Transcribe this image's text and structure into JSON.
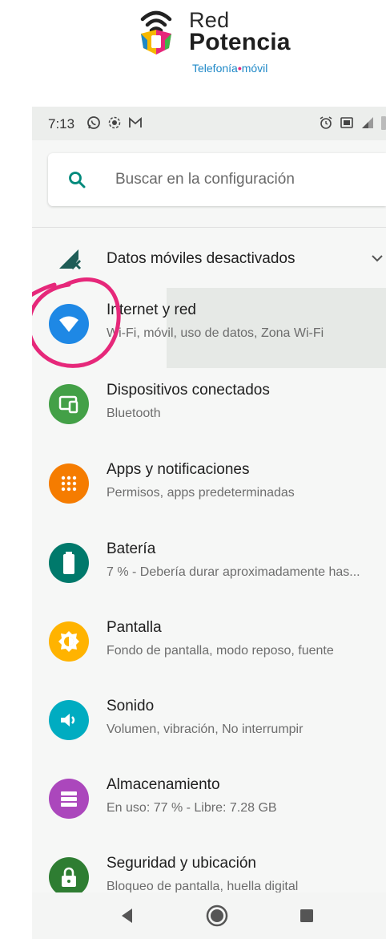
{
  "brand": {
    "line1": "Red",
    "line2": "Potencia",
    "tagline_a": "Telefonía",
    "tagline_sep": "•",
    "tagline_b": "móvil",
    "colors": {
      "blue": "#1e88c7",
      "pink": "#e6287a",
      "yellow": "#f6b800",
      "green": "#41b649"
    }
  },
  "status_bar": {
    "time": "7:13",
    "icons_left": [
      "whatsapp-icon",
      "record-icon",
      "gmail-icon"
    ],
    "icons_right": [
      "alarm-icon",
      "cast-icon",
      "signal-icon",
      "battery-icon"
    ]
  },
  "search": {
    "placeholder": "Buscar en la configuración",
    "icon": "search-icon"
  },
  "mobile_data_banner": {
    "label": "Datos móviles desactivados",
    "icon": "mobile-data-off-icon"
  },
  "settings": [
    {
      "title": "Internet y red",
      "subtitle": "Wi-Fi, móvil, uso de datos, Zona Wi-Fi",
      "icon": "wifi-icon",
      "color": "#1e88e5"
    },
    {
      "title": "Dispositivos conectados",
      "subtitle": "Bluetooth",
      "icon": "devices-icon",
      "color": "#43a047"
    },
    {
      "title": "Apps y notificaciones",
      "subtitle": "Permisos, apps predeterminadas",
      "icon": "apps-icon",
      "color": "#f57c00"
    },
    {
      "title": "Batería",
      "subtitle": "7 % - Debería durar aproximadamente has...",
      "icon": "battery-icon",
      "color": "#00796b"
    },
    {
      "title": "Pantalla",
      "subtitle": "Fondo de pantalla, modo reposo, fuente",
      "icon": "brightness-icon",
      "color": "#ffb300"
    },
    {
      "title": "Sonido",
      "subtitle": "Volumen, vibración, No interrumpir",
      "icon": "volume-icon",
      "color": "#00acc1"
    },
    {
      "title": "Almacenamiento",
      "subtitle": "En uso: 77 % - Libre: 7.28 GB",
      "icon": "storage-icon",
      "color": "#ab47bc"
    },
    {
      "title": "Seguridad y ubicación",
      "subtitle": "Bloqueo de pantalla, huella digital",
      "icon": "lock-icon",
      "color": "#2e7d32"
    }
  ],
  "annotation": {
    "color": "#e6287a"
  },
  "nav": [
    "back-icon",
    "home-icon",
    "recents-icon"
  ]
}
